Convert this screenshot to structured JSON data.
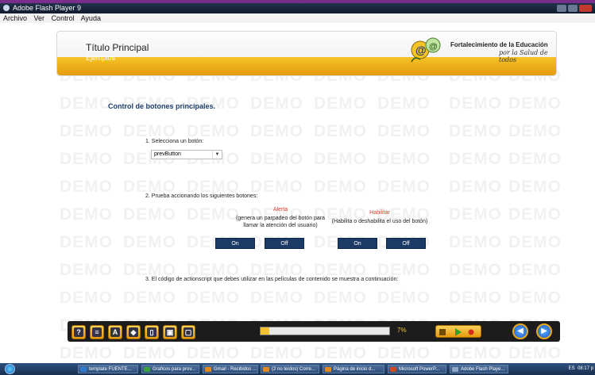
{
  "window": {
    "title": "Adobe Flash Player 9"
  },
  "menu": [
    "Archivo",
    "Ver",
    "Control",
    "Ayuda"
  ],
  "header": {
    "title": "Título Principal",
    "subtitle": "Ejemplos",
    "brand_line1": "Fortalecimiento de la Educación",
    "brand_line2": "por la Salud de todos"
  },
  "watermark": "DEMO",
  "content": {
    "section_title": "Control de botones principales.",
    "step1": "1. Selecciona un botón:",
    "select_value": "prevButton",
    "step2": "2. Prueba accionando los siguientes botones:",
    "alert": {
      "title": "Alerta",
      "desc1": "(genera un parpadeo del botón para",
      "desc2": "llamar la atención del usuario)",
      "on": "On",
      "off": "Off"
    },
    "enable": {
      "title": "Habilitar",
      "desc1": "(Habilita o deshabilita el uso del botón)",
      "on": "On",
      "off": "Off"
    },
    "step3": "3. El código de actionscript que debes utilizar en las películas de contenido se muestra a continuación:"
  },
  "toolbar": {
    "tools": [
      {
        "icon": "help-icon",
        "glyph": "?"
      },
      {
        "icon": "list-icon",
        "glyph": "≡"
      },
      {
        "icon": "text-icon",
        "glyph": "A"
      },
      {
        "icon": "comment-icon",
        "glyph": "◆"
      },
      {
        "icon": "book-icon",
        "glyph": "▯"
      },
      {
        "icon": "print-icon",
        "glyph": "▣"
      },
      {
        "icon": "page-icon",
        "glyph": "▢"
      }
    ],
    "progress_percent": 7,
    "progress_label": "7%"
  },
  "taskbar": {
    "items": [
      {
        "label": "template FUENTE...",
        "color": "#2f7bd0"
      },
      {
        "label": "Graficos para prov...",
        "color": "#3aa040"
      },
      {
        "label": "Gmail - Recibidos ...",
        "color": "#e08a1e"
      },
      {
        "label": "(2 no leídos) Corre...",
        "color": "#e08a1e"
      },
      {
        "label": "Página de inicio d...",
        "color": "#e08a1e"
      },
      {
        "label": "Microsoft PowerP...",
        "color": "#d24726"
      },
      {
        "label": "Adobe Flash Playe...",
        "color": "#8fa6c4"
      }
    ],
    "lang": "ES",
    "time": "08:17 p"
  }
}
